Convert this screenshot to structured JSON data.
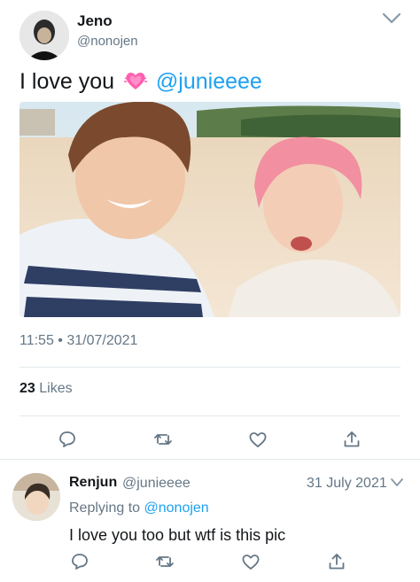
{
  "tweet": {
    "author_name": "Jeno",
    "author_handle": "@nonojen",
    "text_main": "I love you",
    "text_emoji": "growing-heart-emoji",
    "text_mention": "@junieeee",
    "timestamp": "11:55 • 31/07/2021",
    "likes_count": "23",
    "likes_label": "Likes"
  },
  "reply": {
    "author_name": "Renjun",
    "author_handle": "@junieeee",
    "date": "31 July 2021",
    "replying_prefix": "Replying to",
    "replying_to": "@nonojen",
    "text": "I love you too but wtf is this pic"
  },
  "icons": {
    "reply": "comment-icon",
    "retweet": "retweet-icon",
    "like": "heart-icon",
    "share": "share-icon",
    "more": "chevron-down-icon"
  },
  "colors": {
    "link": "#1da1f2",
    "secondary_text": "#657786",
    "divider": "#e1e8ed",
    "emoji_heart": "#ff5fae"
  }
}
